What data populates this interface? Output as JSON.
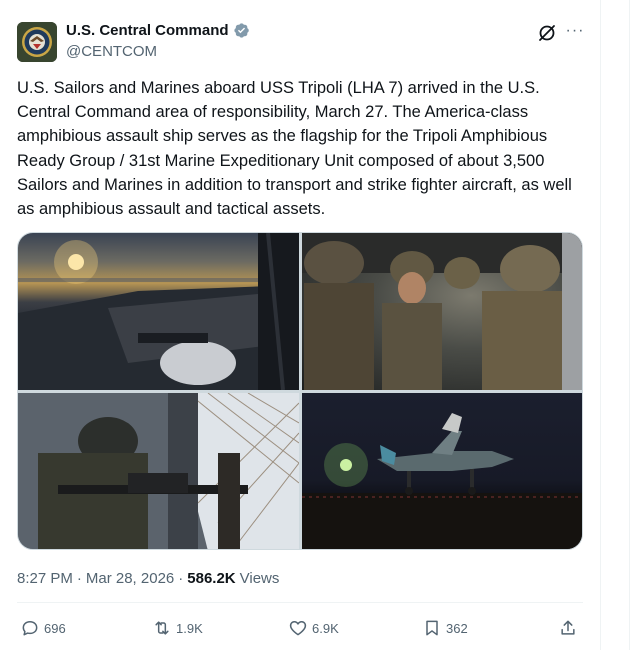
{
  "author": {
    "name": "U.S. Central Command",
    "handle": "@CENTCOM",
    "verified": true
  },
  "icons": {
    "verified": "verified-badge-icon",
    "grok": "grok-icon",
    "more": "more-options-icon",
    "reply": "reply-icon",
    "repost": "repost-icon",
    "like": "heart-icon",
    "bookmark": "bookmark-icon",
    "share": "share-icon"
  },
  "more_label": "···",
  "tweet": {
    "text": "U.S. Sailors and Marines aboard USS Tripoli (LHA 7) arrived in the U.S. Central Command area of responsibility, March 27. The America-class amphibious assault ship serves as the flagship for the Tripoli Amphibious Ready Group / 31st Marine Expeditionary Unit composed of about 3,500 Sailors and Marines in addition to transport and strike fighter aircraft, as well as amphibious assault and tactical assets."
  },
  "meta": {
    "time": "8:27 PM",
    "separator1": "·",
    "date": "Mar 28, 2026",
    "separator2": "·",
    "views_count": "586.2K",
    "views_label": "Views"
  },
  "actions": {
    "replies": "696",
    "reposts": "1.9K",
    "likes": "6.9K",
    "bookmarks": "362"
  },
  "colors": {
    "text": "#0f1419",
    "secondary": "#536471",
    "verified": "#829aab",
    "border": "#eff3f4"
  }
}
